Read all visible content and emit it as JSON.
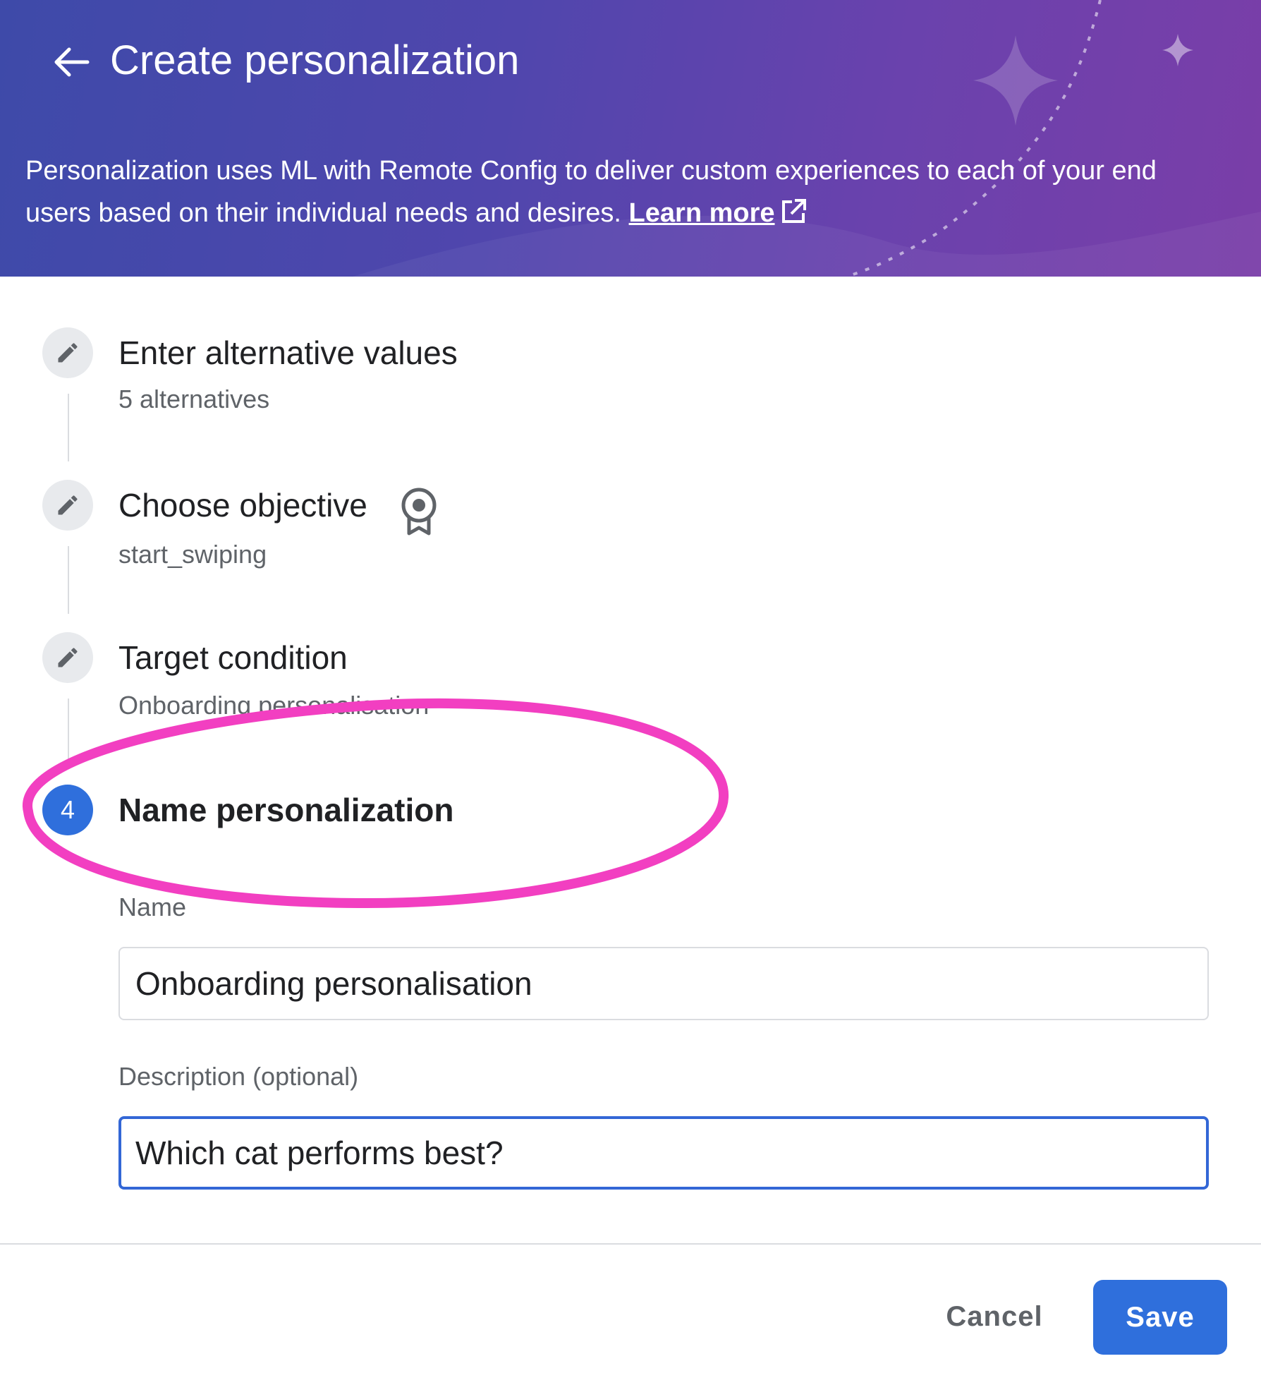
{
  "header": {
    "title": "Create personalization",
    "description": "Personalization uses ML with Remote Config to deliver custom experiences to each of your end users based on their individual needs and desires.",
    "learn_more_label": "Learn more"
  },
  "steps": [
    {
      "title": "Enter alternative values",
      "subtitle": "5 alternatives",
      "state": "edit"
    },
    {
      "title": "Choose objective",
      "subtitle": "start_swiping",
      "state": "edit",
      "icon": "award-icon"
    },
    {
      "title": "Target condition",
      "subtitle": "Onboarding personalisation",
      "state": "edit"
    },
    {
      "title": "Name personalization",
      "number": "4",
      "state": "active"
    }
  ],
  "form": {
    "name_label": "Name",
    "name_value": "Onboarding personalisation",
    "description_label": "Description (optional)",
    "description_value": "Which cat performs best?"
  },
  "footer": {
    "cancel_label": "Cancel",
    "save_label": "Save"
  },
  "colors": {
    "header_gradient_start": "#3e4aa9",
    "header_gradient_end": "#7a3ea8",
    "primary": "#2f6fdc",
    "annotation": "#f23fc1"
  }
}
